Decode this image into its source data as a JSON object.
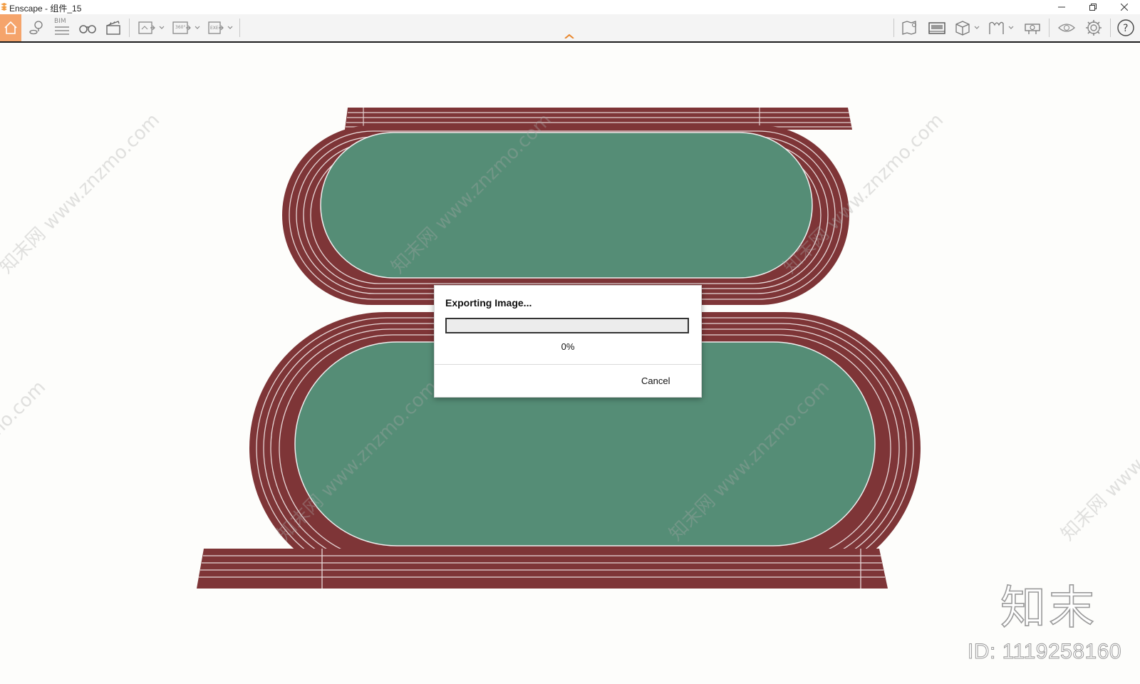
{
  "window": {
    "title": "Enscape - 组件_15"
  },
  "toolbar": {
    "bim_label": "BIM",
    "accent_color": "#f5a46b"
  },
  "dialog": {
    "title": "Exporting Image...",
    "progress_text": "0%",
    "progress_fraction": 0,
    "cancel_label": "Cancel"
  },
  "scene": {
    "track_color": "#7e3537",
    "field_color": "#558d76"
  },
  "watermark": {
    "text": "知末网 www.znzmo.com",
    "logo": "知末",
    "id_text": "ID: 1119258160"
  }
}
